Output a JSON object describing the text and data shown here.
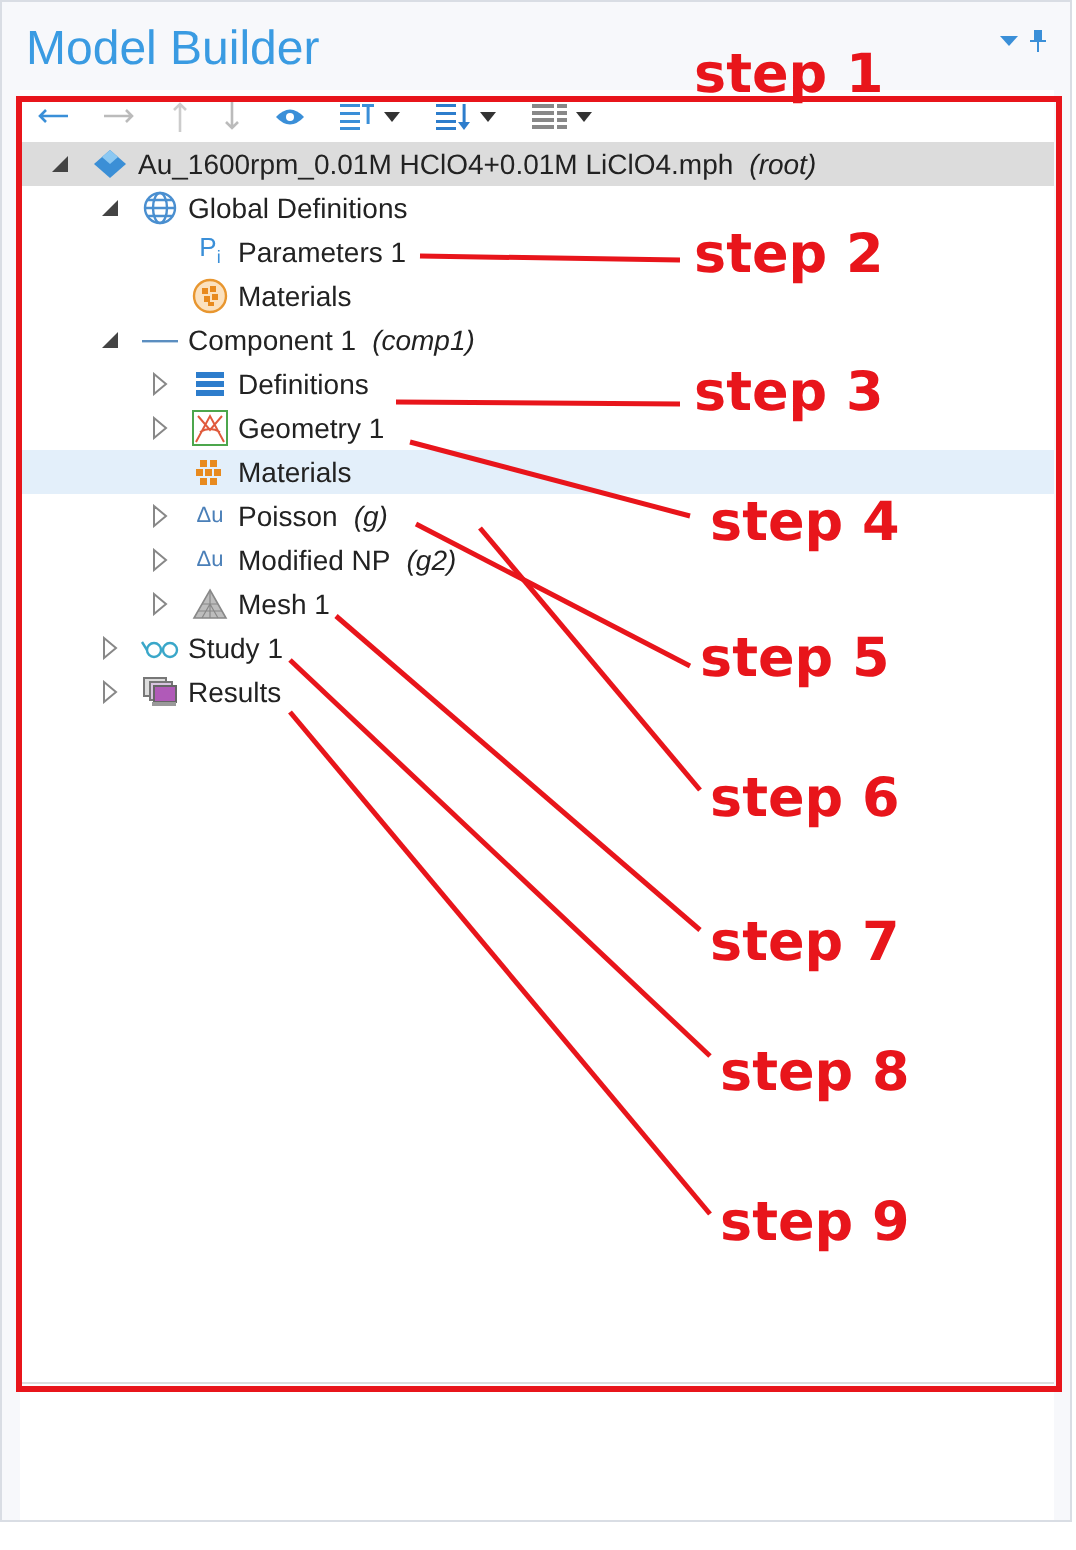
{
  "panel": {
    "title": "Model Builder"
  },
  "tree": [
    {
      "label": "Au_1600rpm_0.01M HClO4+0.01M LiClO4.mph",
      "note": "(root)",
      "kind": "model",
      "expanded": true,
      "selected": true,
      "children": [
        {
          "label": "Global Definitions",
          "kind": "globe",
          "expanded": true,
          "selected": false,
          "children": [
            {
              "label": "Parameters 1",
              "icon_text": "P$_{i}$",
              "kind": "parameters",
              "selected": false
            },
            {
              "label": "Materials",
              "kind": "materials-round",
              "selected": false
            }
          ]
        },
        {
          "label": "Component 1",
          "note": "(comp1)",
          "kind": "component",
          "expanded": true,
          "selected": false,
          "children": [
            {
              "label": "Definitions",
              "kind": "definitions",
              "expanded": false,
              "selected": false
            },
            {
              "label": "Geometry 1",
              "kind": "geometry",
              "expanded": false,
              "selected": false
            },
            {
              "label": "Materials",
              "kind": "materials",
              "selected": false,
              "highlighted": true
            },
            {
              "label": "Poisson",
              "note": "(g)",
              "icon_text": "Δu",
              "kind": "physics",
              "expanded": false,
              "selected": false
            },
            {
              "label": "Modified NP",
              "note": "(g2)",
              "icon_text": "Δu",
              "kind": "physics",
              "expanded": false,
              "selected": false
            },
            {
              "label": "Mesh 1",
              "kind": "mesh",
              "expanded": false,
              "selected": false
            }
          ]
        },
        {
          "label": "Study 1",
          "kind": "study",
          "expanded": false,
          "selected": false
        },
        {
          "label": "Results",
          "kind": "results",
          "expanded": false,
          "selected": false
        }
      ]
    }
  ],
  "annotations": [
    {
      "label": "step 1"
    },
    {
      "label": "step 2"
    },
    {
      "label": "step 3"
    },
    {
      "label": "step 4"
    },
    {
      "label": "step 5"
    },
    {
      "label": "step 6"
    },
    {
      "label": "step 7"
    },
    {
      "label": "step 8"
    },
    {
      "label": "step 9"
    }
  ]
}
